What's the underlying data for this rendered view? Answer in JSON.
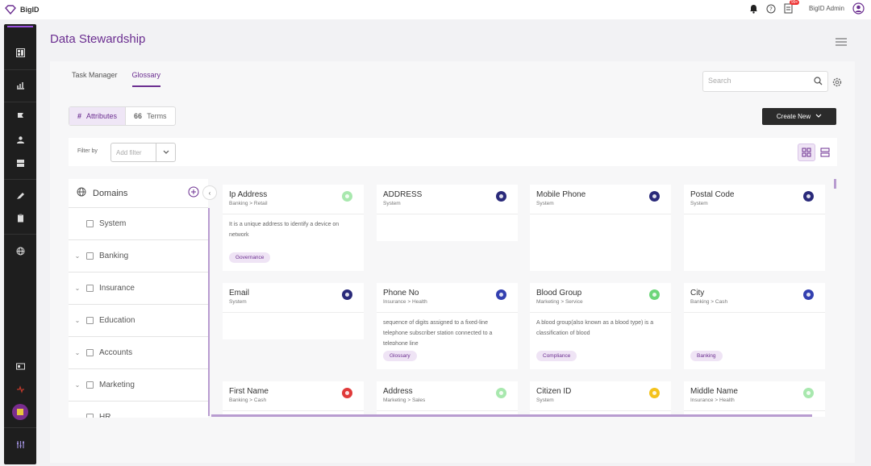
{
  "app": {
    "name": "BigID"
  },
  "topbar": {
    "badge": "99+",
    "user": "BigID Admin"
  },
  "page": {
    "title": "Data Stewardship"
  },
  "tabs": [
    {
      "label": "Task Manager"
    },
    {
      "label": "Glossary"
    }
  ],
  "search": {
    "placeholder": "Search"
  },
  "toggle": {
    "attributes": "Attributes",
    "terms": "Terms"
  },
  "create_button": "Create New",
  "filter": {
    "label": "Filter by",
    "placeholder": "Add filter"
  },
  "domains": {
    "title": "Domains",
    "items": [
      "System",
      "Banking",
      "Insurance",
      "Education",
      "Accounts",
      "Marketing",
      "HR"
    ]
  },
  "colors": {
    "accent": "#6b2e90",
    "navy": "#2a2a7a",
    "green": "#6dd67a",
    "red": "#e03a3a",
    "yellow": "#f4c21b"
  },
  "cards": [
    {
      "name": "Ip Address",
      "sub": "Banking > Retail",
      "desc": "It is a unique address to identify a device on network",
      "tag": "Governance",
      "status": "green"
    },
    {
      "name": "ADDRESS",
      "sub": "System",
      "desc": "",
      "tag": "",
      "status": "navy"
    },
    {
      "name": "Mobile Phone",
      "sub": "System",
      "desc": "",
      "tag": "",
      "status": "navy"
    },
    {
      "name": "Postal Code",
      "sub": "System",
      "desc": "",
      "tag": "",
      "status": "navy"
    },
    {
      "name": "Email",
      "sub": "System",
      "desc": "",
      "tag": "",
      "status": "navy"
    },
    {
      "name": "Phone No",
      "sub": "Insurance > Health",
      "desc": "sequence of digits assigned to a fixed-line telephone subscriber station connected to a telephone line",
      "tag": "Glossary",
      "status": "navy"
    },
    {
      "name": "Blood Group",
      "sub": "Marketing > Service",
      "desc": "A blood group(also known as a blood type) is a classification of blood",
      "tag": "Compliance",
      "status": "green"
    },
    {
      "name": "City",
      "sub": "Banking > Cash",
      "desc": "",
      "tag": "Banking",
      "status": "navy"
    },
    {
      "name": "First Name",
      "sub": "Banking > Cash",
      "desc": "",
      "tag": "",
      "status": "red"
    },
    {
      "name": "Address",
      "sub": "Marketing > Sales",
      "desc": "",
      "tag": "",
      "status": "green"
    },
    {
      "name": "Citizen ID",
      "sub": "System",
      "desc": "",
      "tag": "",
      "status": "yellow"
    },
    {
      "name": "Middle Name",
      "sub": "Insurance > Health",
      "desc": "",
      "tag": "",
      "status": "green"
    }
  ]
}
